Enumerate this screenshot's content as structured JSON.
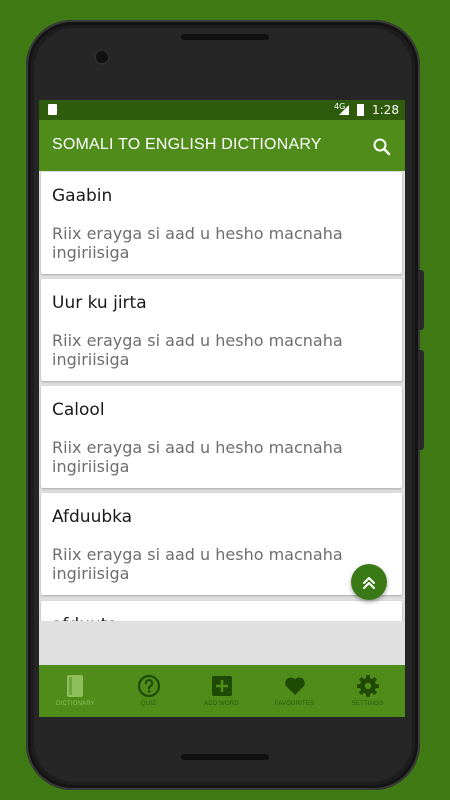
{
  "status_bar": {
    "network": "4G",
    "time": "1:28"
  },
  "app_bar": {
    "title": "SOMALI TO ENGLISH DICTIONARY",
    "search_icon": "search-icon"
  },
  "words": [
    {
      "word": "Gaabin",
      "hint": "Riix erayga si aad u hesho macnaha ingiriisiga"
    },
    {
      "word": "Uur ku jirta",
      "hint": "Riix erayga si aad u hesho macnaha ingiriisiga"
    },
    {
      "word": "Calool",
      "hint": "Riix erayga si aad u hesho macnaha ingiriisiga"
    },
    {
      "word": "Afduubka",
      "hint": "Riix erayga si aad u hesho macnaha ingiriisiga"
    },
    {
      "word": "afduuta",
      "hint": ""
    }
  ],
  "fab": {
    "icon": "double-chevron-up-icon"
  },
  "bottom_nav": [
    {
      "label": "DICTIONARY",
      "icon": "book-icon",
      "active": true
    },
    {
      "label": "QUIZ",
      "icon": "question-circle-icon",
      "active": false
    },
    {
      "label": "ADD WORD",
      "icon": "plus-box-icon",
      "active": false
    },
    {
      "label": "FAVOURITES",
      "icon": "heart-icon",
      "active": false
    },
    {
      "label": "SETTINGS",
      "icon": "gear-icon",
      "active": false
    }
  ],
  "colors": {
    "background": "#3f7a14",
    "primary": "#4f8c1a",
    "status_bar": "#2f5c0c",
    "fab": "#3a7a16"
  }
}
